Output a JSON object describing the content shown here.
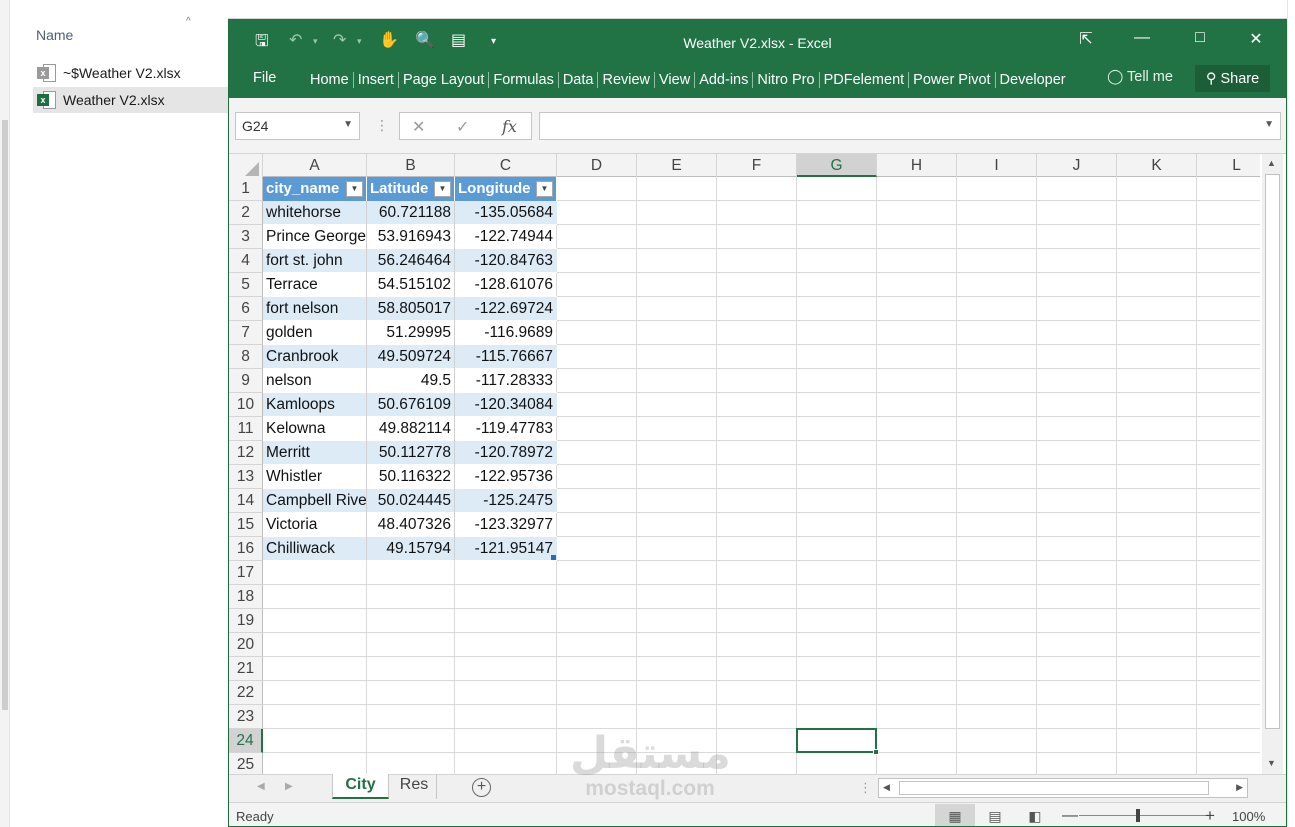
{
  "explorer": {
    "column_header": "Name",
    "files": [
      {
        "name": "~$Weather V2.xlsx",
        "selected": false
      },
      {
        "name": "Weather V2.xlsx",
        "selected": true
      }
    ]
  },
  "window": {
    "title": "Weather V2.xlsx - Excel",
    "accent_color": "#217346"
  },
  "ribbon": {
    "file": "File",
    "tabs": [
      "Home",
      "Insert",
      "Page Layout",
      "Formulas",
      "Data",
      "Review",
      "View",
      "Add-ins",
      "Nitro Pro",
      "PDFelement",
      "Power Pivot",
      "Developer"
    ],
    "tell_me": "Tell me",
    "share": "Share"
  },
  "formula_bar": {
    "name_box": "G24",
    "fx": "fx",
    "formula": ""
  },
  "columns": [
    "A",
    "B",
    "C",
    "D",
    "E",
    "F",
    "G",
    "H",
    "I",
    "J",
    "K",
    "L"
  ],
  "active_column": "G",
  "active_row": 24,
  "table": {
    "headers": [
      "city_name",
      "Latitude",
      "Longitude"
    ],
    "rows": [
      [
        "whitehorse",
        "60.721188",
        "-135.05684"
      ],
      [
        "Prince George",
        "53.916943",
        "-122.74944"
      ],
      [
        "fort st. john",
        "56.246464",
        "-120.84763"
      ],
      [
        "Terrace",
        "54.515102",
        "-128.61076"
      ],
      [
        "fort nelson",
        "58.805017",
        "-122.69724"
      ],
      [
        "golden",
        "51.29995",
        "-116.9689"
      ],
      [
        "Cranbrook",
        "49.509724",
        "-115.76667"
      ],
      [
        "nelson",
        "49.5",
        "-117.28333"
      ],
      [
        "Kamloops",
        "50.676109",
        "-120.34084"
      ],
      [
        "Kelowna",
        "49.882114",
        "-119.47783"
      ],
      [
        "Merritt",
        "50.112778",
        "-120.78972"
      ],
      [
        "Whistler",
        "50.116322",
        "-122.95736"
      ],
      [
        "Campbell River",
        "50.024445",
        "-125.2475"
      ],
      [
        "Victoria",
        "48.407326",
        "-123.32977"
      ],
      [
        "Chilliwack",
        "49.15794",
        "-121.95147"
      ]
    ]
  },
  "row_numbers": [
    "1",
    "2",
    "3",
    "4",
    "5",
    "6",
    "7",
    "8",
    "9",
    "10",
    "11",
    "12",
    "13",
    "14",
    "15",
    "16",
    "17",
    "18",
    "19",
    "20",
    "21",
    "22",
    "23",
    "24",
    "25"
  ],
  "sheets": [
    {
      "name": "City",
      "active": true
    },
    {
      "name": "Res",
      "active": false
    }
  ],
  "status": {
    "ready": "Ready",
    "zoom": "100%"
  },
  "watermark": {
    "arabic": "مستقل",
    "latin": "mostaql.com"
  }
}
